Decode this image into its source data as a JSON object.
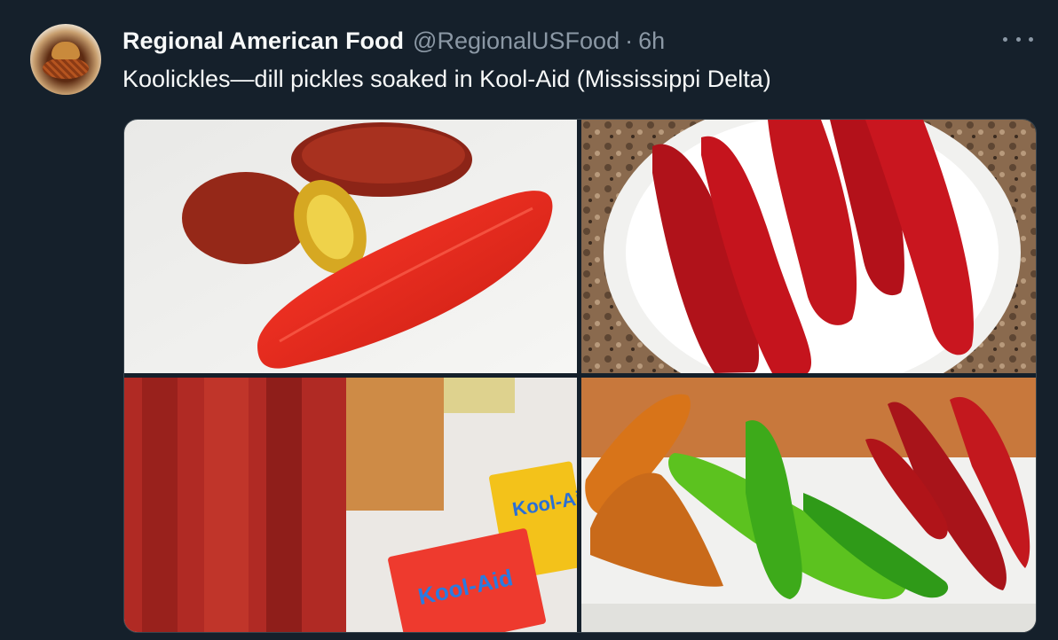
{
  "tweet": {
    "author_name": "Regional American Food",
    "handle": "@RegionalUSFood",
    "separator": "·",
    "time": "6h",
    "text": "Koolickles—dill pickles soaked in Kool-Aid (Mississippi Delta)"
  },
  "media": {
    "images": [
      {
        "description": "red-dyed pickles cut open on white surface"
      },
      {
        "description": "red pickles on a white plate"
      },
      {
        "description": "jar of red pickles with Kool-Aid packets"
      },
      {
        "description": "multicolored pickle spears on a tray"
      }
    ],
    "packet_labels": [
      "Kool-Aid",
      "Kool-Aid"
    ]
  },
  "colors": {
    "background": "#15202b",
    "text_primary": "#f7f9f9",
    "text_secondary": "#8b98a5",
    "border": "#38444d"
  }
}
